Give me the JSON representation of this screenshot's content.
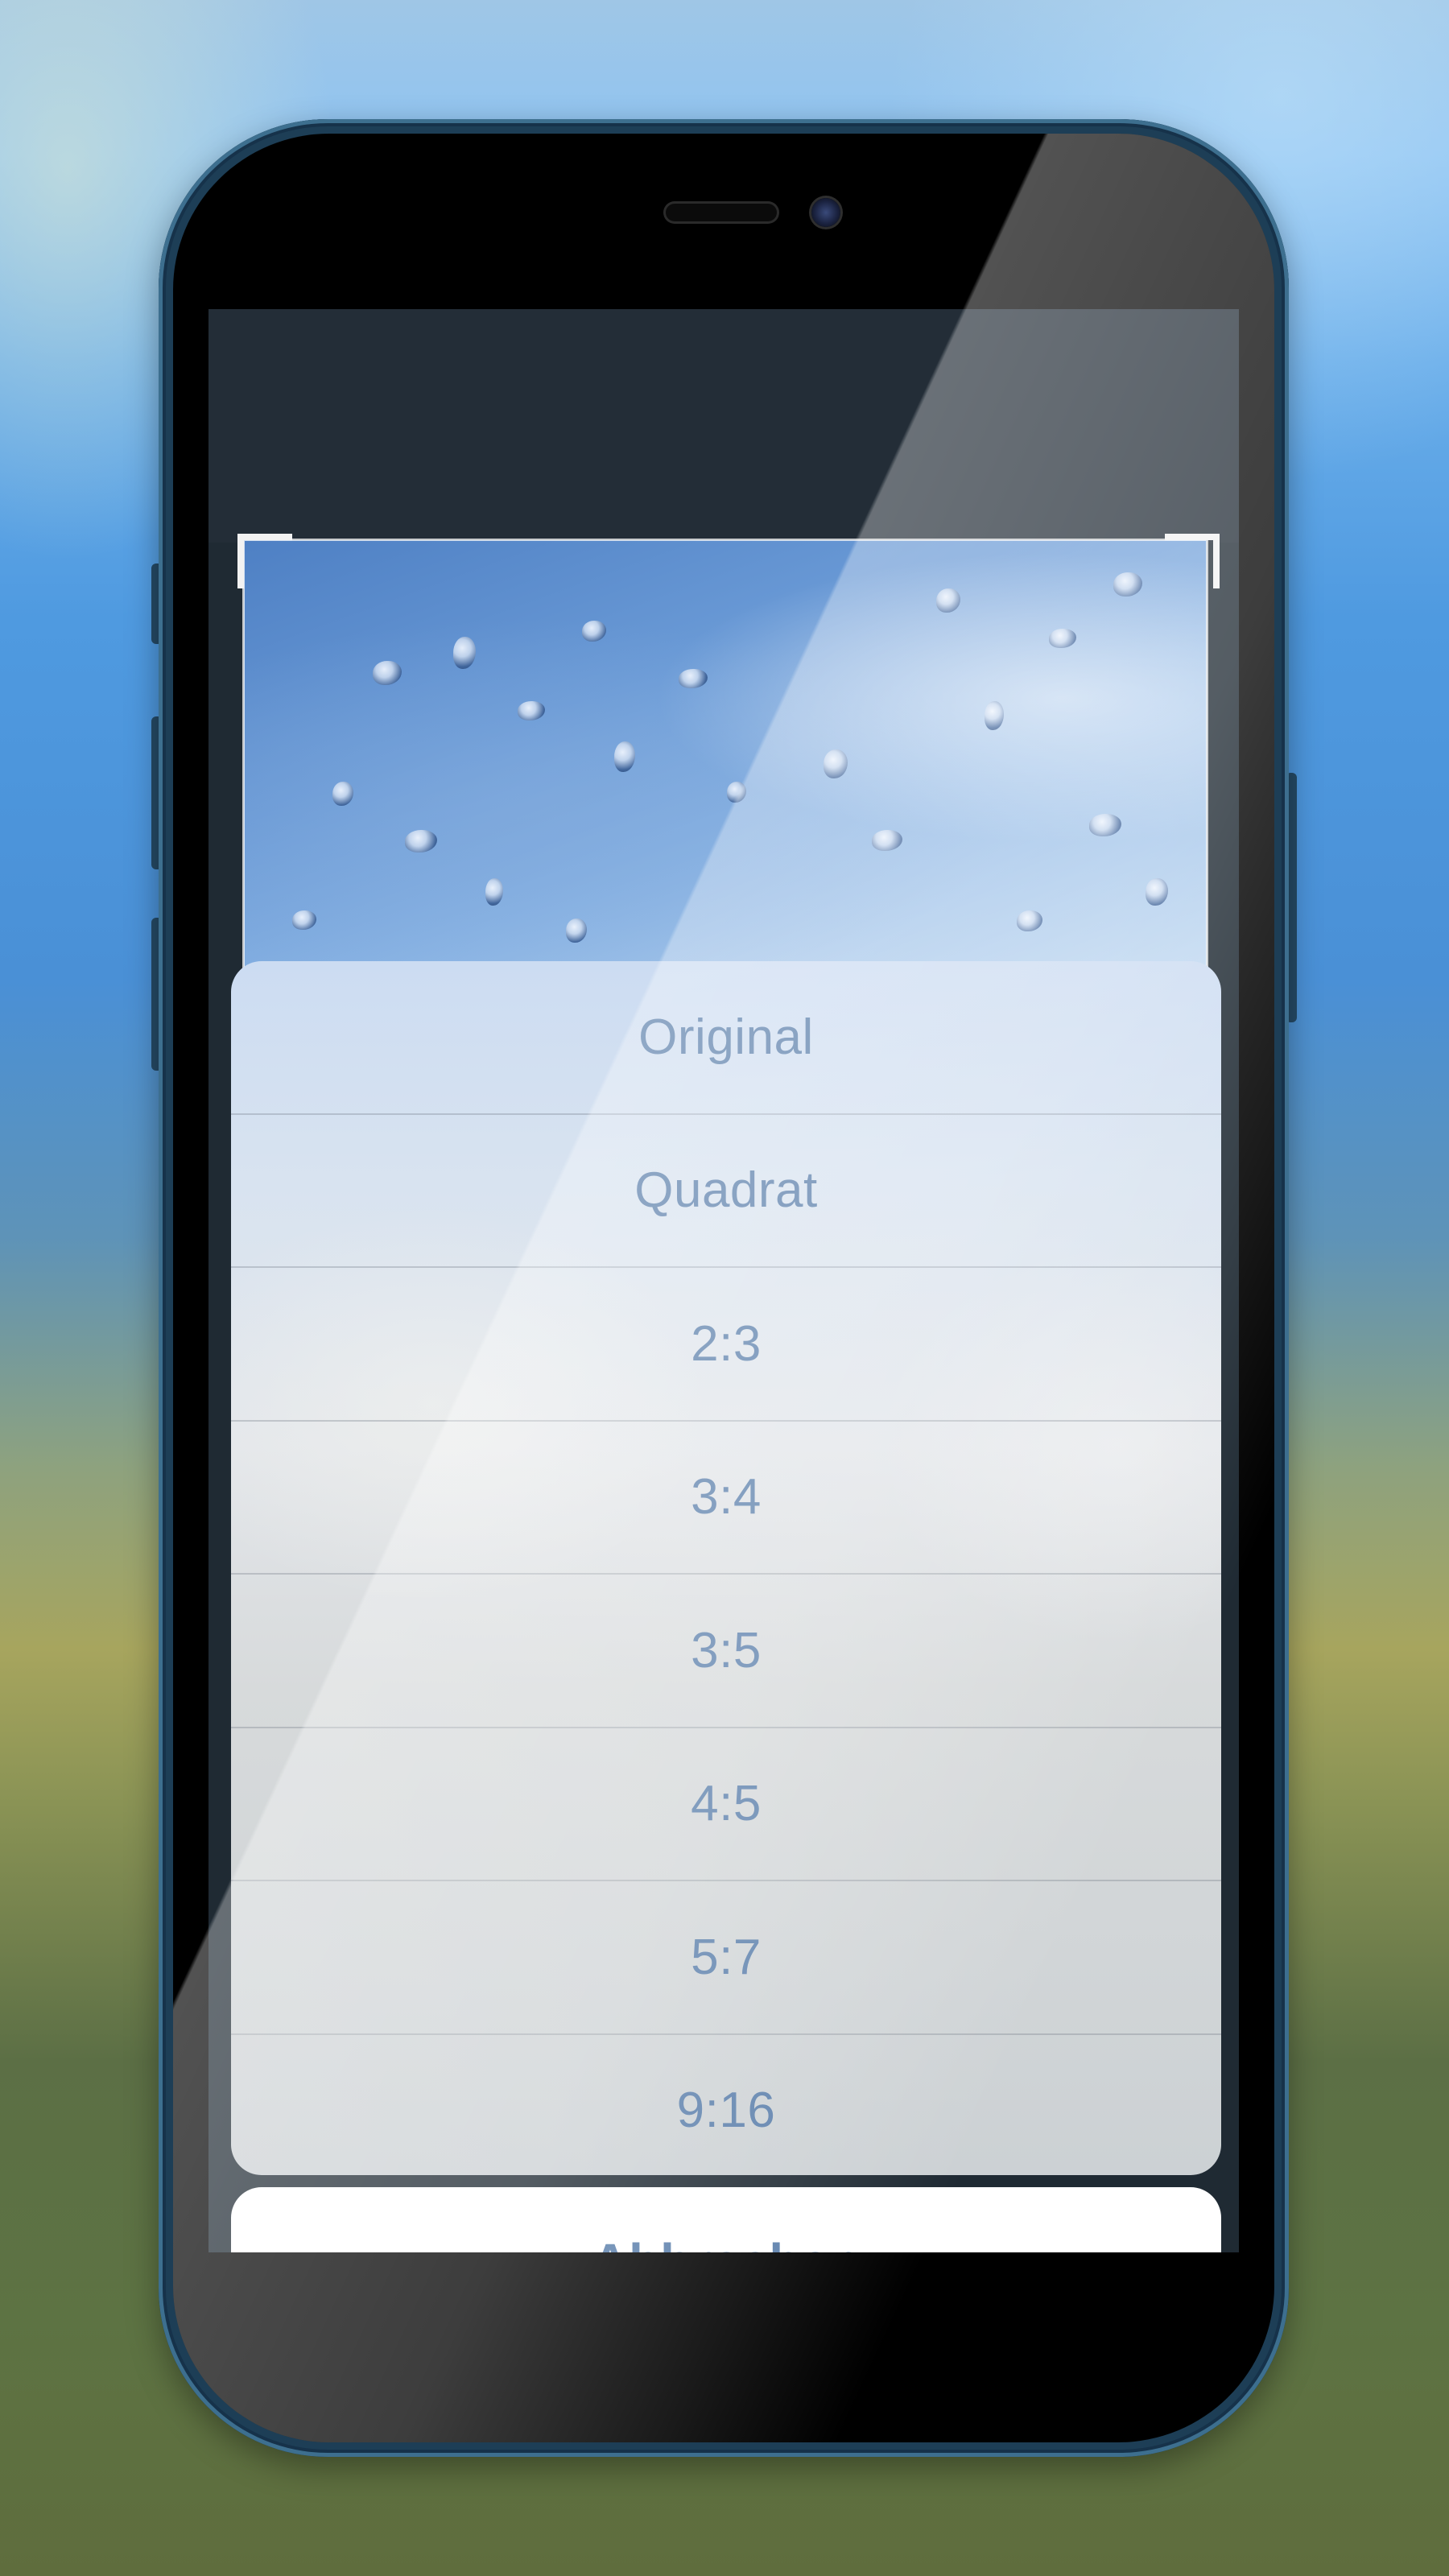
{
  "action_sheet": {
    "items": [
      {
        "label": "Original"
      },
      {
        "label": "Quadrat"
      },
      {
        "label": "2:3"
      },
      {
        "label": "3:4"
      },
      {
        "label": "3:5"
      },
      {
        "label": "4:5"
      },
      {
        "label": "5:7"
      },
      {
        "label": "9:16"
      }
    ],
    "cancel_label": "Abbrechen"
  },
  "colors": {
    "accent": "#5b7fab",
    "sheet_background": "#dfe4ea",
    "cancel_background": "#ffffff"
  },
  "icons": [
    "earpiece-speaker-icon",
    "front-camera-icon",
    "crop-corner-icon"
  ]
}
